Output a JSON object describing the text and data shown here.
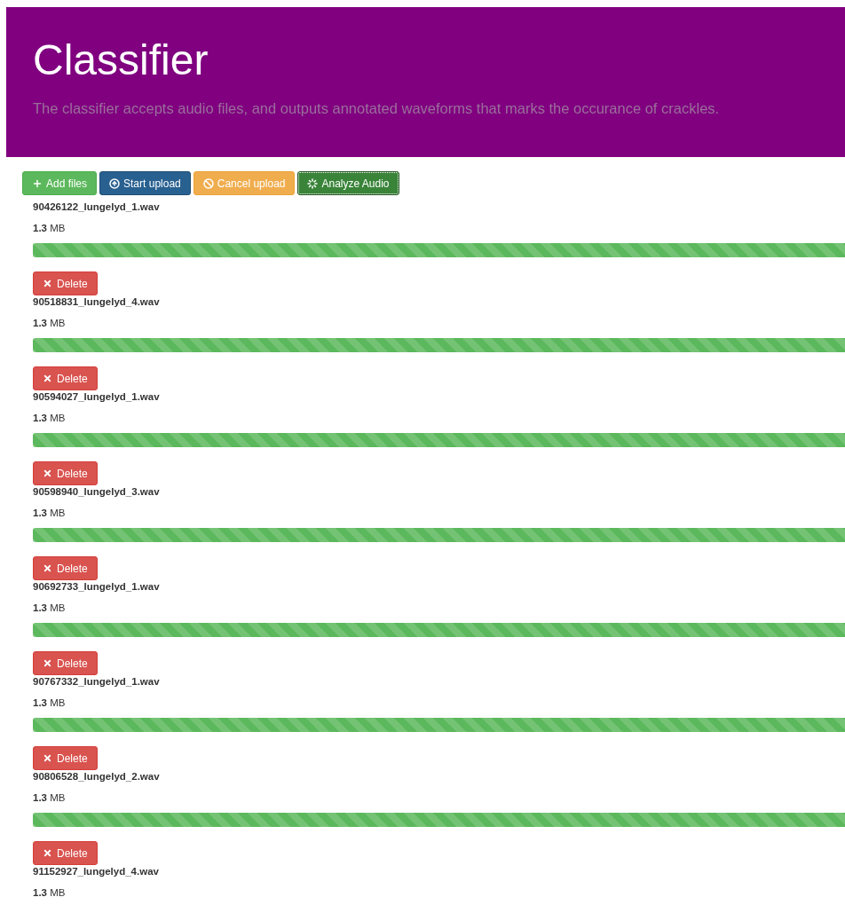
{
  "header": {
    "title": "Classifier",
    "subtitle": "The classifier accepts audio files, and outputs annotated waveforms that marks the occurance of crackles."
  },
  "toolbar": [
    {
      "kind": "add",
      "label": "Add files"
    },
    {
      "kind": "start",
      "label": "Start upload"
    },
    {
      "kind": "cancel",
      "label": "Cancel upload"
    },
    {
      "kind": "analyze",
      "label": "Analyze Audio"
    }
  ],
  "files": [
    {
      "name": "90426122_lungelyd_1.wav",
      "size": "**1.3** MB",
      "level": 1,
      "delete": "Delete"
    },
    {
      "name": "90518831_lungelyd_4.wav",
      "size": "**1.3** MB",
      "level": 1,
      "delete": "Delete"
    },
    {
      "name": "90594027_lungelyd_1.wav",
      "size": "**1.3** MB",
      "level": 1,
      "delete": "Delete"
    },
    {
      "name": "90598940_lungelyd_3.wav",
      "size": "**1.3** MB",
      "level": 1,
      "delete": "Delete"
    },
    {
      "name": "90692733_lungelyd_1.wav",
      "size": "**1.3** MB",
      "level": 1,
      "delete": "Delete"
    },
    {
      "name": "90767332_lungelyd_1.wav",
      "size": "**1.3** MB",
      "level": 1,
      "delete": "Delete"
    },
    {
      "name": "90806528_lungelyd_2.wav",
      "size": "**1.3** MB",
      "level": 1,
      "delete": "Delete"
    },
    {
      "name": "91152927_lungelyd_4.wav",
      "size": "**1.3** MB"
    }
  ]
}
